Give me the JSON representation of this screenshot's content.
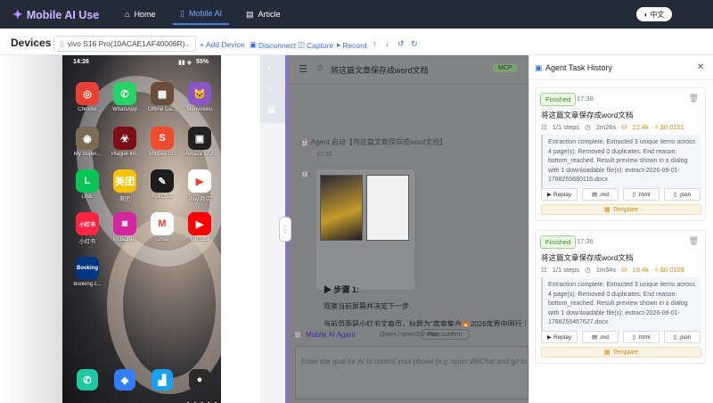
{
  "nav": {
    "logo": "Mobile AI Use",
    "home": "Home",
    "mobile_ai": "Mobile AI",
    "article": "Article",
    "lang": "中文"
  },
  "toolbar": {
    "title": "Devices",
    "device": "vivo S16 Pro(10ACAE1AF40006R)",
    "add_device": "+ Add Device",
    "disconnect": "Disconnect",
    "capture": "Capture",
    "record": "Record"
  },
  "phone": {
    "time": "14:26",
    "battery": "55%",
    "apps": [
      {
        "label": "Chrome",
        "glyph": "◎",
        "color": "#e94235"
      },
      {
        "label": "WhatsApp",
        "glyph": "✆",
        "color": "#25d366"
      },
      {
        "label": "Offline Ga...",
        "glyph": "▦",
        "color": "#6b4d3a"
      },
      {
        "label": "Meowdoku",
        "glyph": "🐱",
        "color": "#8b56c8"
      },
      {
        "label": "My Super...",
        "glyph": "◉",
        "color": "#7a6b55"
      },
      {
        "label": "Plague Inc.",
        "glyph": "☣",
        "color": "#7c0f16"
      },
      {
        "label": "Shopee SG",
        "glyph": "S",
        "color": "#ee4d2d"
      },
      {
        "label": "Amaze GO!",
        "glyph": "▣",
        "color": "#222222"
      },
      {
        "label": "LINE",
        "glyph": "L",
        "color": "#06c755"
      },
      {
        "label": "美团",
        "glyph": "美团",
        "color": "#f7c500"
      },
      {
        "label": "ApkClaw",
        "glyph": "✎",
        "color": "#1d1d1d"
      },
      {
        "label": "Play 商店",
        "glyph": "▶",
        "color": "#ffffff"
      },
      {
        "label": "小红书",
        "glyph": "小红书",
        "color": "#ff2442"
      },
      {
        "label": "Instagram",
        "glyph": "◙",
        "color": "#d6249f"
      },
      {
        "label": "Gmail",
        "glyph": "M",
        "color": "#ffffff"
      },
      {
        "label": "YouTube",
        "glyph": "▶",
        "color": "#ff0000"
      },
      {
        "label": "Booking.c...",
        "glyph": "Booking",
        "color": "#003580"
      }
    ],
    "dock": [
      {
        "glyph": "✆",
        "color": "#1fc8a0"
      },
      {
        "glyph": "◈",
        "color": "#2f7ef5"
      },
      {
        "glyph": "▟",
        "color": "#17a1f2"
      },
      {
        "glyph": "●",
        "color": "#2a2a2a"
      }
    ]
  },
  "chat": {
    "title": "将这篇文章保存成word文档",
    "mcp": "MCP",
    "agent_msg": "Agent 启动【将这篇文章保存成word文档】",
    "agent_time": "17:36",
    "step": "▶ 步骤 1:",
    "observe": "观察当前屏幕并决定下一步",
    "current": "当前页面是小红书文章页，标题为\"库索集合🔥2026库界中国行｜四地",
    "agent_name": "Mobile AI Agent",
    "model": "Qwen / qwen3.6-max",
    "plan": "Plan confirm",
    "placeholder": "Enter the goal for AI to control your phone (e.g. open WeChat and go to C"
  },
  "panel": {
    "title": "Agent Task History",
    "tasks": [
      {
        "status": "Finished",
        "time": "17:38",
        "name": "将这篇文章保存成word文档",
        "steps": "1/1 steps",
        "duration": "2m26s",
        "tokens": "22.4k · ≈ $0.0151",
        "result": "Extraction complete. Extracted 3 unique items across 4 page(s). Removed 0 duplicates. End reason: bottom_reached. Result preview shown in a dialog with 1 downloadable file(s): extract-2026-09-01-1788255680116.docx",
        "replay": "Replay",
        "md": ".md",
        "html": ".html",
        "json": ".json",
        "template": "Template"
      },
      {
        "status": "Finished",
        "time": "17:36",
        "name": "将这篇文章保存成word文档",
        "steps": "1/1 steps",
        "duration": "1m34s",
        "tokens": "19.4k · ≈ $0.0109",
        "result": "Extraction complete. Extracted 3 unique items across 4 page(s). Removed 0 duplicates. End reason: bottom_reached. Result preview shown in a dialog with 1 downloadable file(s): extract-2026-09-01-1788255467627.docx",
        "replay": "Replay",
        "md": ".md",
        "html": ".html",
        "json": ".json",
        "template": "Template"
      }
    ]
  }
}
